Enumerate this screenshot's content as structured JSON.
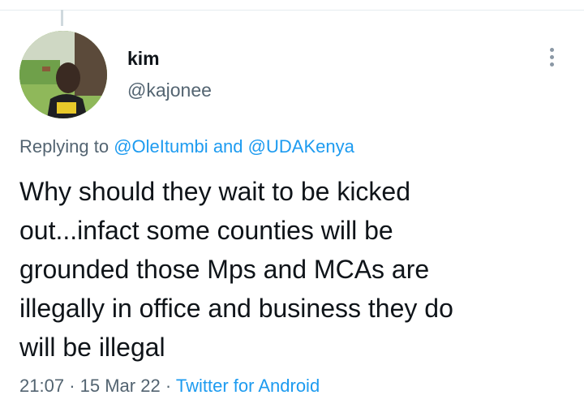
{
  "tweet": {
    "author": {
      "display_name": "kim",
      "handle": "@kajonee"
    },
    "replying_to": {
      "prefix": "Replying to",
      "mentions": [
        "@OleItumbi",
        "@UDAKenya"
      ],
      "joiner": "and"
    },
    "text": "Why should they wait to be kicked\nout...infact some counties will be\ngrounded those Mps and MCAs are\nillegally in office and business they do\nwill be illegal",
    "meta": {
      "time": "21:07",
      "separator": "·",
      "date": "15 Mar 22",
      "source": "Twitter for Android"
    }
  },
  "icons": {
    "more": "more-vertical-icon"
  },
  "colors": {
    "text": "#0f1419",
    "secondary": "#536471",
    "link": "#1d9bf0",
    "divider": "#e6ecf0"
  }
}
